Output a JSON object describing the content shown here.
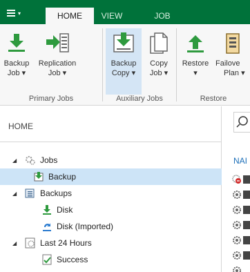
{
  "tabs": {
    "home": "HOME",
    "view": "VIEW",
    "job": "JOB"
  },
  "ribbon": {
    "backup_job": [
      "Backup",
      "Job ▾"
    ],
    "replication_job": [
      "Replication",
      "Job ▾"
    ],
    "backup_copy": [
      "Backup",
      "Copy ▾"
    ],
    "copy_job": [
      "Copy",
      "Job ▾"
    ],
    "restore": [
      "Restore",
      "▾"
    ],
    "failover_plan": [
      "Failove",
      "Plan ▾"
    ],
    "groups": {
      "primary": "Primary Jobs",
      "auxiliary": "Auxiliary Jobs",
      "restore": "Restore"
    }
  },
  "tree": {
    "title": "HOME",
    "items": {
      "jobs": "Jobs",
      "backup": "Backup",
      "backups": "Backups",
      "disk": "Disk",
      "disk_imported": "Disk (Imported)",
      "last24": "Last 24 Hours",
      "success": "Success"
    }
  },
  "right": {
    "column_header": "NAI"
  },
  "colors": {
    "tabbar": "#00723a",
    "ribbon": "#f7f7f7",
    "selected": "#cde4f7",
    "accent_green": "#2e9a3e"
  }
}
